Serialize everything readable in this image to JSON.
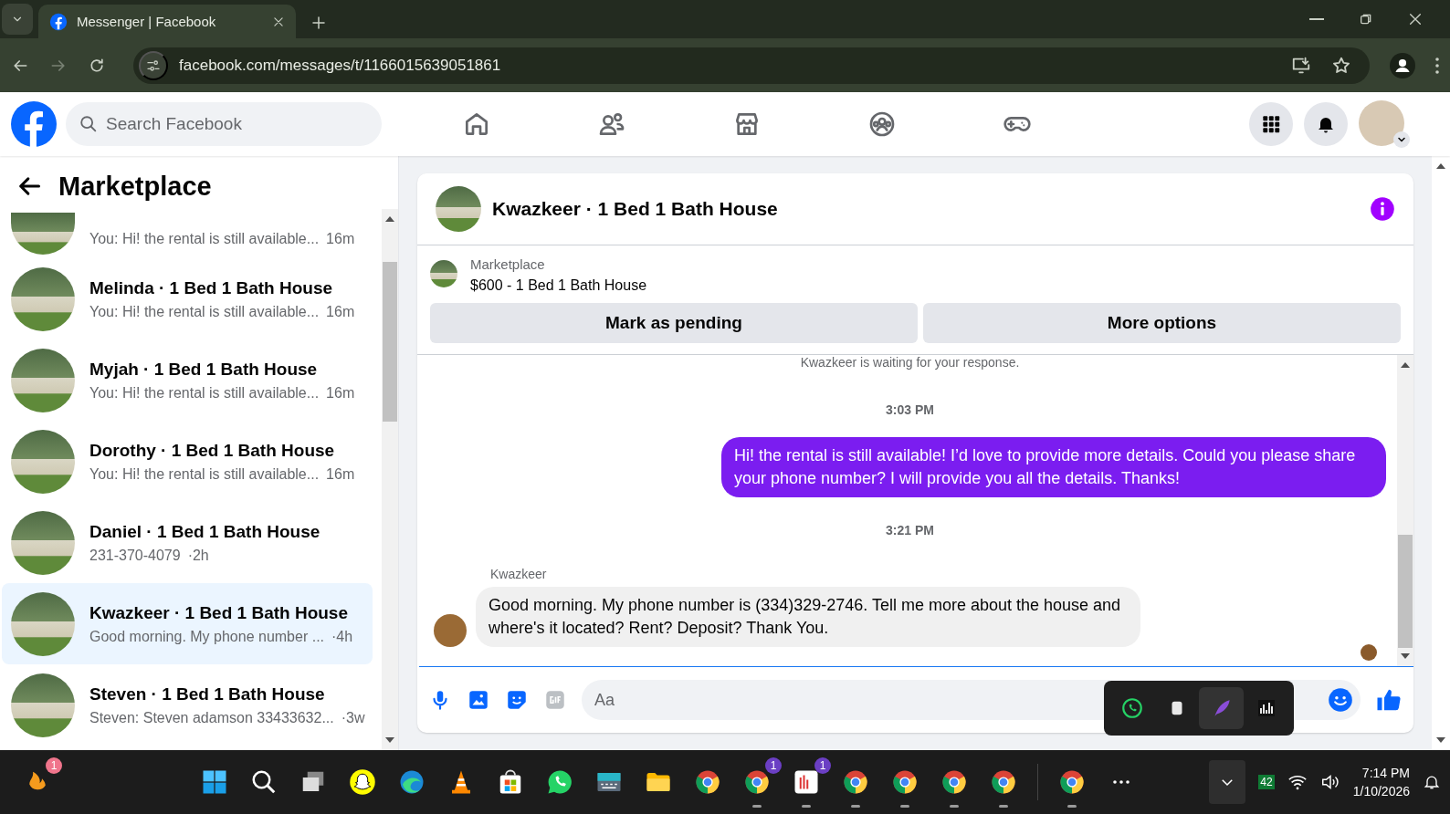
{
  "browser": {
    "tab_title": "Messenger | Facebook",
    "url": "facebook.com/messages/t/1166015639051861",
    "forward_disabled": true
  },
  "topbar": {
    "search": {
      "placeholder": "Search Facebook"
    }
  },
  "sidebar": {
    "title": "Marketplace",
    "conversations": [
      {
        "preview": "You: Hi! the rental is still available...",
        "time": "16m",
        "selected": false
      },
      {
        "name": "Melinda · 1 Bed 1 Bath House",
        "preview": "You: Hi! the rental is still available...",
        "time": "16m",
        "selected": false
      },
      {
        "name": "Myjah · 1 Bed 1 Bath House",
        "preview": "You: Hi! the rental is still available...",
        "time": "16m",
        "selected": false
      },
      {
        "name": "Dorothy · 1 Bed 1 Bath House",
        "preview": "You: Hi! the rental is still available...",
        "time": "16m",
        "selected": false
      },
      {
        "name": "Daniel · 1 Bed 1 Bath House",
        "preview": "231-370-4079",
        "time": "·2h",
        "selected": false
      },
      {
        "name": "Kwazkeer · 1 Bed 1 Bath House",
        "preview": "Good morning. My phone number ...",
        "time": "·4h",
        "selected": true
      },
      {
        "name": "Steven · 1 Bed 1 Bath House",
        "preview": "Steven: Steven adamson 33433632...",
        "time": "·3w",
        "selected": false
      }
    ]
  },
  "chat": {
    "title": "Kwazkeer · 1 Bed 1 Bath House",
    "listing": {
      "label": "Marketplace",
      "title": "$600 - 1 Bed 1 Bath House"
    },
    "buttons": [
      "Mark as pending",
      "More options"
    ],
    "notice": "Kwazkeer is waiting for your response.",
    "messages": [
      {
        "kind": "time",
        "text": "3:03 PM"
      },
      {
        "kind": "outgoing",
        "text": "Hi! the rental is still available! I’d love to provide more details. Could you please share your phone number? I will provide you all the details. Thanks!"
      },
      {
        "kind": "time",
        "text": "3:21 PM"
      },
      {
        "kind": "incoming",
        "sender": "Kwazkeer",
        "text": "Good morning. My phone number is (334)329-2746. Tell me more about the house and where's it located? Rent? Deposit? Thank You."
      }
    ],
    "composer": {
      "placeholder": "Aa"
    }
  },
  "taskbar": {
    "apps": [
      {
        "kind": "flame",
        "badge": "1",
        "running": false
      },
      {
        "kind": "start",
        "running": false
      },
      {
        "kind": "search",
        "running": false
      },
      {
        "kind": "taskview",
        "running": false
      },
      {
        "kind": "ghost",
        "running": false
      },
      {
        "kind": "wave",
        "running": false
      },
      {
        "kind": "cone",
        "running": false
      },
      {
        "kind": "bag",
        "running": false
      },
      {
        "kind": "phone",
        "running": false
      },
      {
        "kind": "keyboard",
        "running": false
      },
      {
        "kind": "folder",
        "running": false
      },
      {
        "kind": "browser",
        "running": false
      },
      {
        "kind": "browser",
        "badge": "1",
        "running": true
      },
      {
        "kind": "chart",
        "badge": "1",
        "running": true
      },
      {
        "kind": "browser",
        "running": true
      },
      {
        "kind": "browser",
        "running": true
      },
      {
        "kind": "browser",
        "running": true
      },
      {
        "kind": "browser",
        "running": true
      },
      {
        "kind": "separator"
      },
      {
        "kind": "browser",
        "running": true
      },
      {
        "kind": "more",
        "running": false
      }
    ],
    "tray_badge": "42",
    "clock": "7:14 PM",
    "date": "1/10/2026"
  }
}
